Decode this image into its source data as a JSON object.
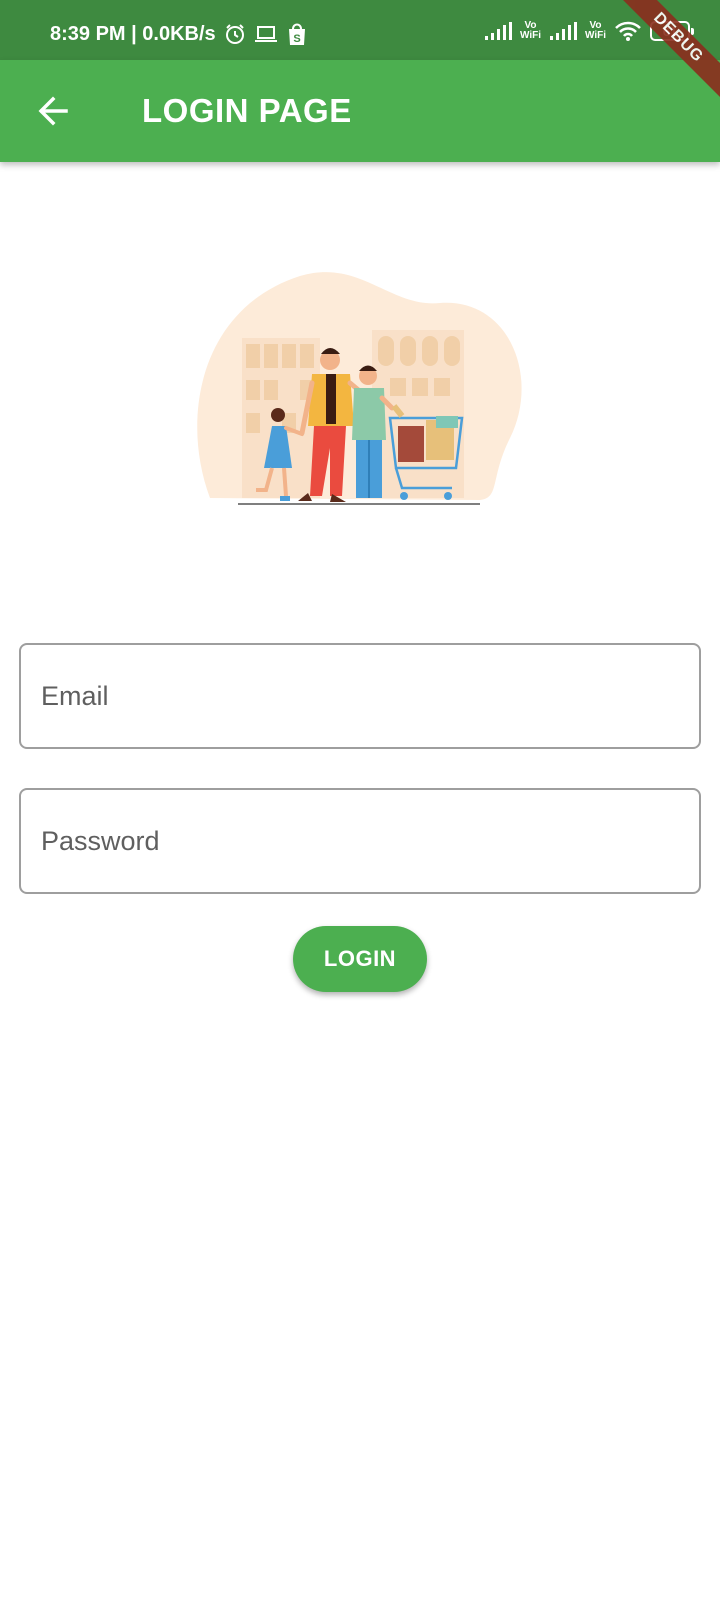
{
  "status_bar": {
    "time_speed": "8:39 PM | 0.0KB/s",
    "vowifi_1": [
      "Vo",
      "WiFi"
    ],
    "vowifi_2": [
      "Vo",
      "WiFi"
    ],
    "battery": "61",
    "icons": [
      "alarm-icon",
      "laptop-icon",
      "shop-icon",
      "signal-icon",
      "vowifi-icon",
      "wifi-icon",
      "battery-icon"
    ]
  },
  "debug_banner": "DEBUG",
  "app_bar": {
    "title": "LOGIN PAGE",
    "back_icon": "arrow-back-icon",
    "color": "#4caf50"
  },
  "form": {
    "email": {
      "value": "",
      "placeholder": "Email"
    },
    "password": {
      "value": "",
      "placeholder": "Password"
    },
    "login_label": "LOGIN"
  },
  "colors": {
    "primary": "#4caf50",
    "status_bar": "#3e8a40",
    "field_border": "#9e9e9e"
  }
}
